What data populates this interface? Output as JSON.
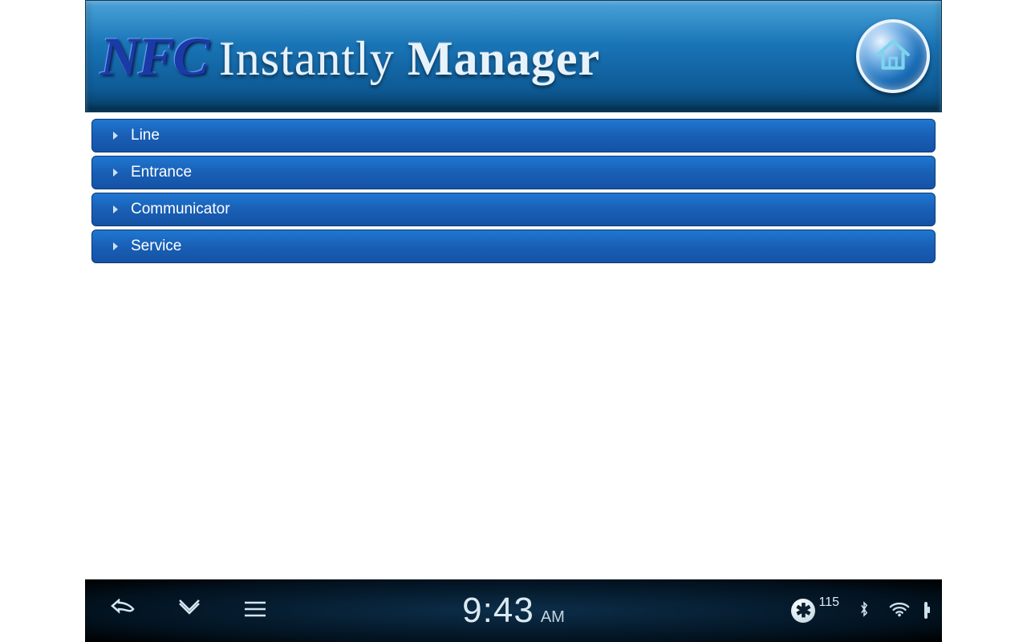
{
  "header": {
    "title_prefix": "NFC",
    "title_mid": "Instantly",
    "title_bold": "Manager",
    "home_icon": "home-icon"
  },
  "menu": {
    "items": [
      {
        "label": "Line"
      },
      {
        "label": "Entrance"
      },
      {
        "label": "Communicator"
      },
      {
        "label": "Service"
      }
    ]
  },
  "navbar": {
    "time": "9:43",
    "ampm": "AM",
    "notification_count": "115"
  }
}
